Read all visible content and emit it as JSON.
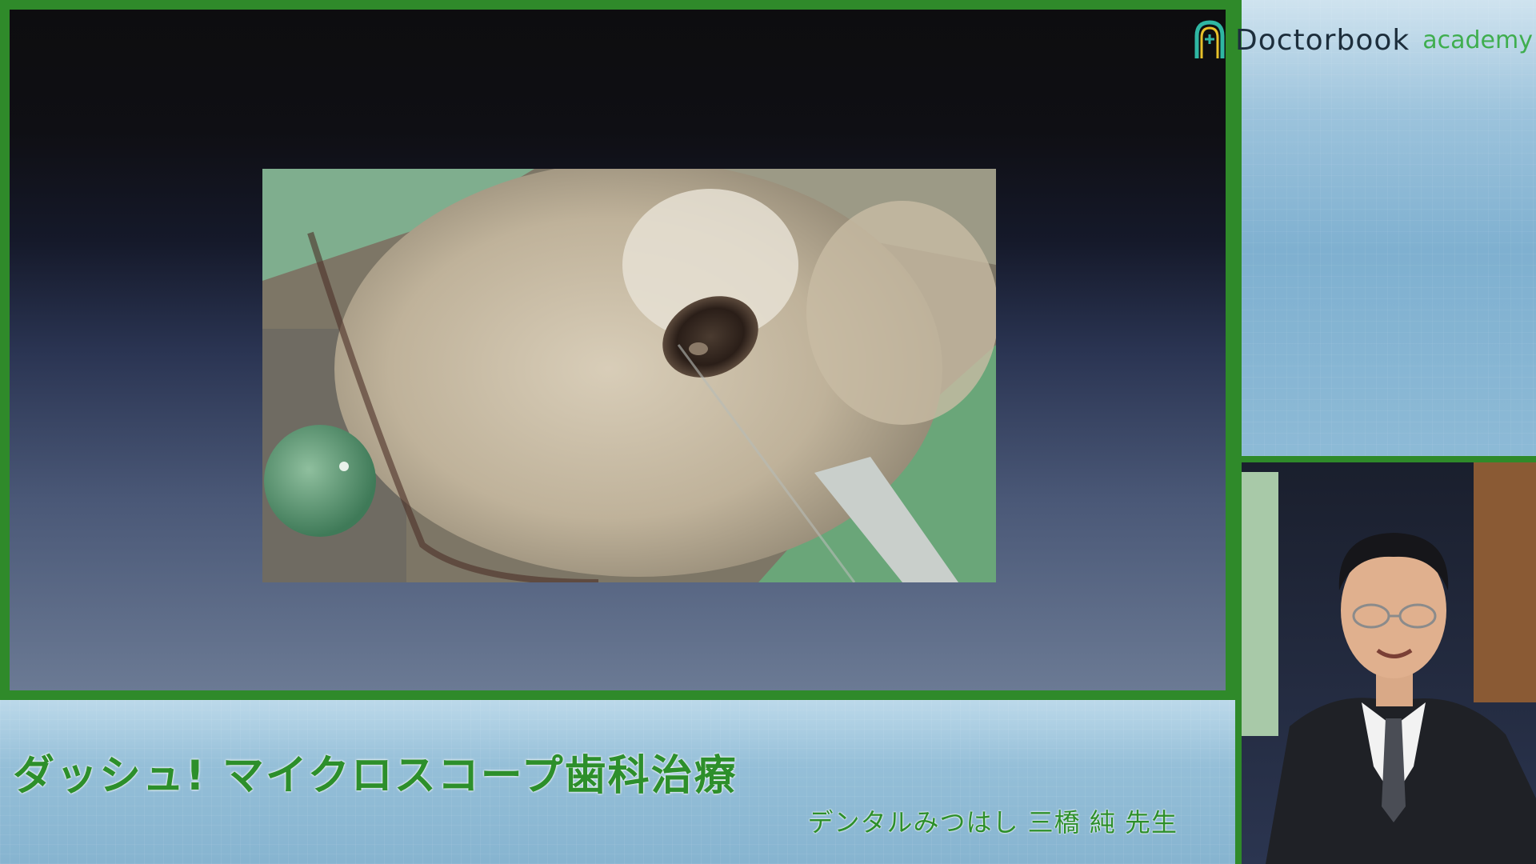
{
  "logo": {
    "name": "Doctorbook",
    "sub": "academy",
    "icon": "tooth-arch-icon",
    "accent": "#3fae4f"
  },
  "banner": {
    "title": "ダッシュ! マイクロスコープ歯科治療",
    "lecturer": "デンタルみつはし 三橋 純 先生"
  },
  "colors": {
    "frame_green": "#2f8a2a",
    "title_green": "#2d8f2b"
  }
}
